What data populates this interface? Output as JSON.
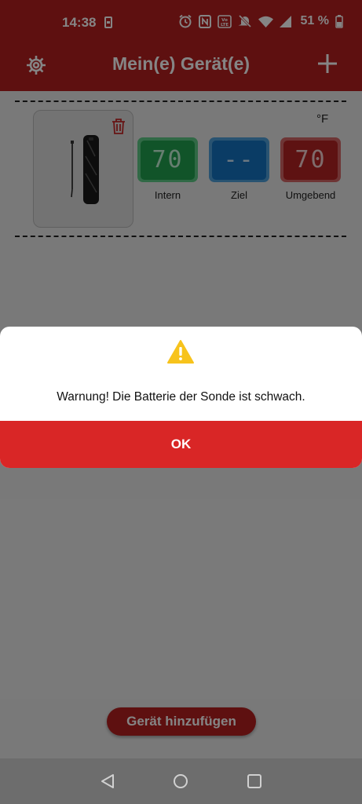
{
  "status_bar": {
    "time": "14:38",
    "battery_percent": "51 %",
    "icons": [
      "sim-icon",
      "alarm-icon",
      "nfc-icon",
      "volte-icon",
      "mute-icon",
      "wifi-icon",
      "signal-icon",
      "battery-icon"
    ]
  },
  "app_bar": {
    "title": "Mein(e) Gerät(e)",
    "left_icon": "gear-icon",
    "right_icon": "plus-icon"
  },
  "device": {
    "unit": "°F",
    "readings": [
      {
        "label": "Intern",
        "value": "70",
        "color": "#22a14f"
      },
      {
        "label": "Ziel",
        "value": "--",
        "color": "#1474c2"
      },
      {
        "label": "Umgebend",
        "value": "70",
        "color": "#b52323"
      }
    ]
  },
  "add_device_label": "Gerät hinzufügen",
  "dialog": {
    "icon": "warning-icon",
    "message": "Warnung! Die Batterie der Sonde ist schwach.",
    "ok_label": "OK"
  },
  "colors": {
    "brand": "#b51f1f",
    "ok_button": "#d92626",
    "warning": "#f7c31c"
  }
}
